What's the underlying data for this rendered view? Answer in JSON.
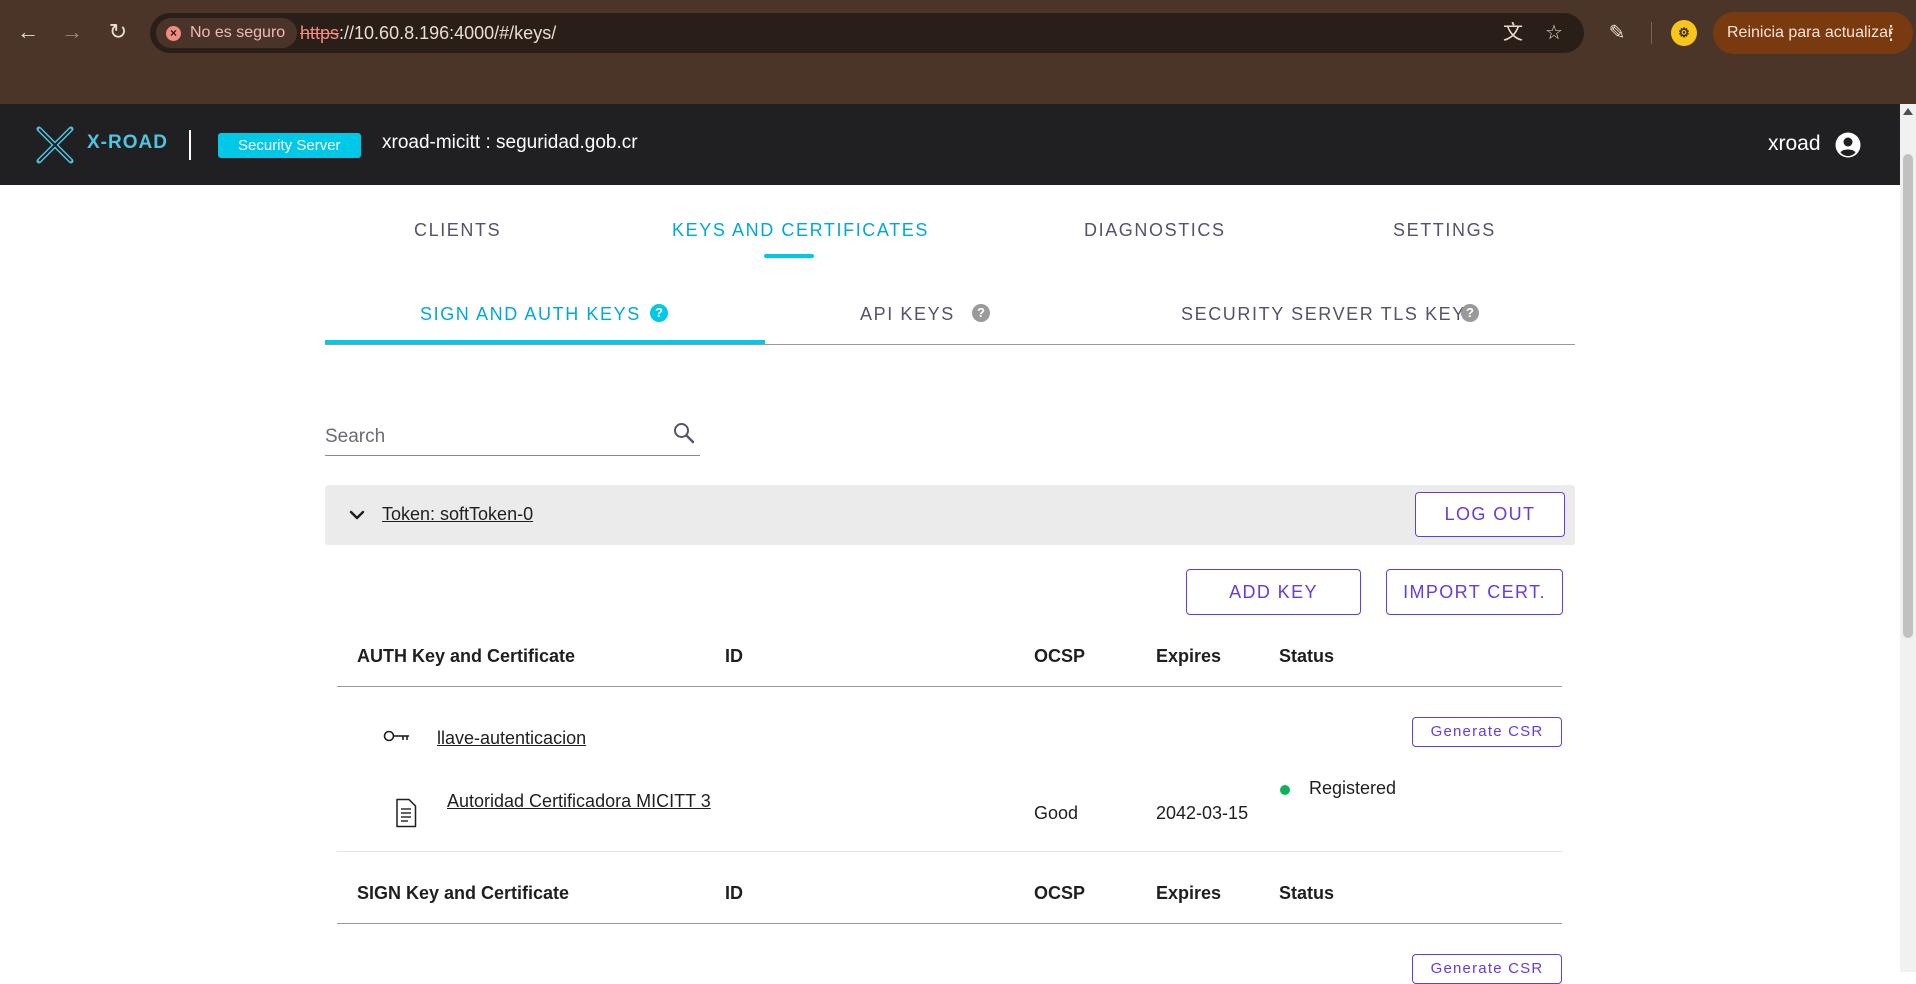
{
  "browser": {
    "security_label": "No es seguro",
    "url_scheme": "https",
    "url_rest": "://10.60.8.196:4000/#/keys/",
    "update_label": "Reinicia para actualizar"
  },
  "header": {
    "logo_text": "X-ROAD",
    "server_chip": "Security Server",
    "server_name": "xroad-micitt : seguridad.gob.cr",
    "user_name": "xroad"
  },
  "main_tabs": [
    {
      "label": "CLIENTS"
    },
    {
      "label": "KEYS AND CERTIFICATES",
      "active": true
    },
    {
      "label": "DIAGNOSTICS"
    },
    {
      "label": "SETTINGS"
    }
  ],
  "sub_tabs": [
    {
      "label": "SIGN AND AUTH KEYS",
      "active": true
    },
    {
      "label": "API KEYS"
    },
    {
      "label": "SECURITY SERVER TLS KEY"
    }
  ],
  "search": {
    "placeholder": "Search"
  },
  "token": {
    "name": "Token: softToken-0",
    "logout_label": "LOG OUT",
    "add_key_label": "ADD KEY",
    "import_cert_label": "IMPORT CERT."
  },
  "auth_table": {
    "headers": [
      "AUTH Key and Certificate",
      "ID",
      "OCSP",
      "Expires",
      "Status"
    ],
    "key_name": "llave-autenticacion",
    "generate_csr_label": "Generate CSR",
    "cert": {
      "name": "Autoridad Certificadora MICITT 3",
      "ocsp": "Good",
      "expires": "2042-03-15",
      "status": "Registered"
    }
  },
  "sign_table": {
    "headers": [
      "SIGN Key and Certificate",
      "ID",
      "OCSP",
      "Expires",
      "Status"
    ],
    "generate_csr_label": "Generate CSR"
  },
  "colors": {
    "accent": "#00c9e8",
    "primary": "#663cdc",
    "header_bg": "#201f21",
    "status_registered": "#0fb25a"
  }
}
